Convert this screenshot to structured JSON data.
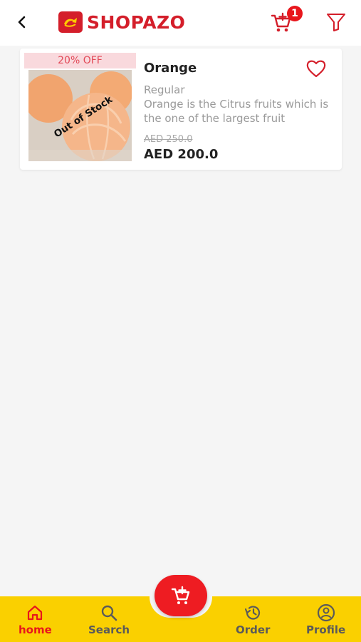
{
  "app": {
    "brand_name": "SHOPAZO"
  },
  "header": {
    "back_icon": "back-arrow-icon",
    "cart_icon": "cart-add-icon",
    "cart_count": "1",
    "filter_icon": "filter-icon"
  },
  "product": {
    "discount_label": "20% OFF",
    "stock_label": "Out of Stock",
    "name": "Orange",
    "variant": "Regular",
    "description": "Orange is the Citrus fruits which is the one of the largest fruit",
    "old_price": "AED 250.0",
    "new_price": "AED 200.0",
    "wishlist_icon": "heart-outline-icon"
  },
  "bottom_nav": {
    "items": [
      {
        "label": "home",
        "icon": "home-icon",
        "active": true
      },
      {
        "label": "Search",
        "icon": "search-icon",
        "active": false
      },
      {
        "label": "Order",
        "icon": "history-icon",
        "active": false
      },
      {
        "label": "Profile",
        "icon": "profile-icon",
        "active": false
      }
    ],
    "fab_icon": "cart-add-icon"
  },
  "colors": {
    "brand_red": "#d41e2a",
    "badge_red": "#e8161c",
    "nav_yellow": "#fad000",
    "discount_bg": "#f9d9dd",
    "discount_text": "#e24a58"
  }
}
